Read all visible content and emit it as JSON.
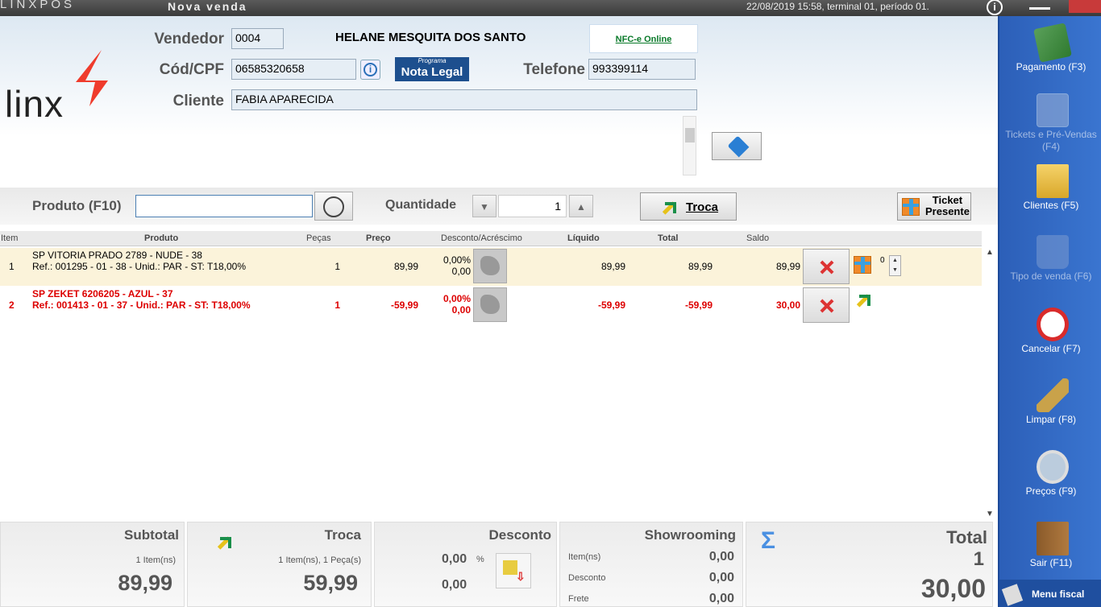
{
  "titlebar": {
    "brand": "LINXPOS",
    "title": "Nova venda",
    "status": "22/08/2019 15:58, terminal 01, período 01.",
    "info_glyph": "i"
  },
  "logo": {
    "text": "linx",
    "accent": "#ef3b2c"
  },
  "header": {
    "vendedor_label": "Vendedor",
    "vendedor_value": "0004",
    "vendedor_name": "HELANE MESQUITA DOS SANTO",
    "nfce_link": "NFC-e Online",
    "cpf_label": "Cód/CPF",
    "cpf_value": "06585320658",
    "nota_legal_small": "Programa",
    "nota_legal_big": "Nota Legal",
    "telefone_label": "Telefone",
    "telefone_value": "993399114",
    "cliente_label": "Cliente",
    "cliente_value": "FABIA APARECIDA"
  },
  "produto": {
    "label": "Produto (F10)",
    "value": "",
    "quantidade_label": "Quantidade",
    "quantidade_value": "1",
    "troca_label": "Troca",
    "ticket_label_1": "Ticket",
    "ticket_label_2": "Presente"
  },
  "grid": {
    "headers": [
      "Item",
      "Produto",
      "Peças",
      "Preço",
      "Desconto/Acréscimo",
      "Líquido",
      "Total",
      "Saldo"
    ],
    "rows": [
      {
        "item": "1",
        "name": "SP VITORIA PRADO 2789 - NUDE - 38",
        "ref": "Ref.: 001295 - 01 - 38 - Unid.: PAR - ST: T18,00%",
        "pecas": "1",
        "preco": "89,99",
        "desc_pct": "0,00%",
        "desc_val": "0,00",
        "liquido": "89,99",
        "total": "89,99",
        "saldo": "89,99",
        "gift_qty": "0"
      },
      {
        "item": "2",
        "name": "SP ZEKET 6206205 - AZUL - 37",
        "ref": "Ref.: 001413 - 01 - 37 - Unid.: PAR - ST: T18,00%",
        "pecas": "1",
        "preco": "-59,99",
        "desc_pct": "0,00%",
        "desc_val": "0,00",
        "liquido": "-59,99",
        "total": "-59,99",
        "saldo": "30,00"
      }
    ]
  },
  "footer": {
    "subtotal": {
      "title": "Subtotal",
      "items": "1 Item(ns)",
      "value": "89,99"
    },
    "troca": {
      "title": "Troca",
      "items": "1 Item(ns), 1 Peça(s)",
      "value": "59,99"
    },
    "desconto": {
      "title": "Desconto",
      "pct": "0,00",
      "pct_sign": "%",
      "value": "0,00"
    },
    "showrooming": {
      "title": "Showrooming",
      "item_label": "Item(ns)",
      "item_value": "0,00",
      "desconto_label": "Desconto",
      "desconto_value": "0,00",
      "frete_label": "Frete",
      "frete_value": "0,00"
    },
    "total": {
      "title": "Total",
      "count": "1",
      "value": "30,00",
      "sigma": "Σ"
    }
  },
  "sidebar": {
    "items": [
      {
        "label": "Pagamento (F3)",
        "icon": "money-icon",
        "enabled": true
      },
      {
        "label": "Tickets e Pré-Vendas (F4)",
        "icon": "tickets-icon",
        "enabled": false
      },
      {
        "label": "Clientes (F5)",
        "icon": "clients-folder-icon",
        "enabled": true
      },
      {
        "label": "Tipo de venda (F6)",
        "icon": "shopping-bag-icon",
        "enabled": false
      },
      {
        "label": "Cancelar (F7)",
        "icon": "cancel-icon",
        "enabled": true
      },
      {
        "label": "Limpar (F8)",
        "icon": "broom-icon",
        "enabled": true
      },
      {
        "label": "Preços (F9)",
        "icon": "price-search-icon",
        "enabled": true
      },
      {
        "label": "Sair (F11)",
        "icon": "exit-door-icon",
        "enabled": true
      }
    ],
    "menu_fiscal": "Menu fiscal"
  },
  "colors": {
    "sidebar": "#3a75d0",
    "row_highlight": "#fbf3da",
    "troca_red": "#dd0000",
    "nfce_green": "#0a7a2a"
  }
}
